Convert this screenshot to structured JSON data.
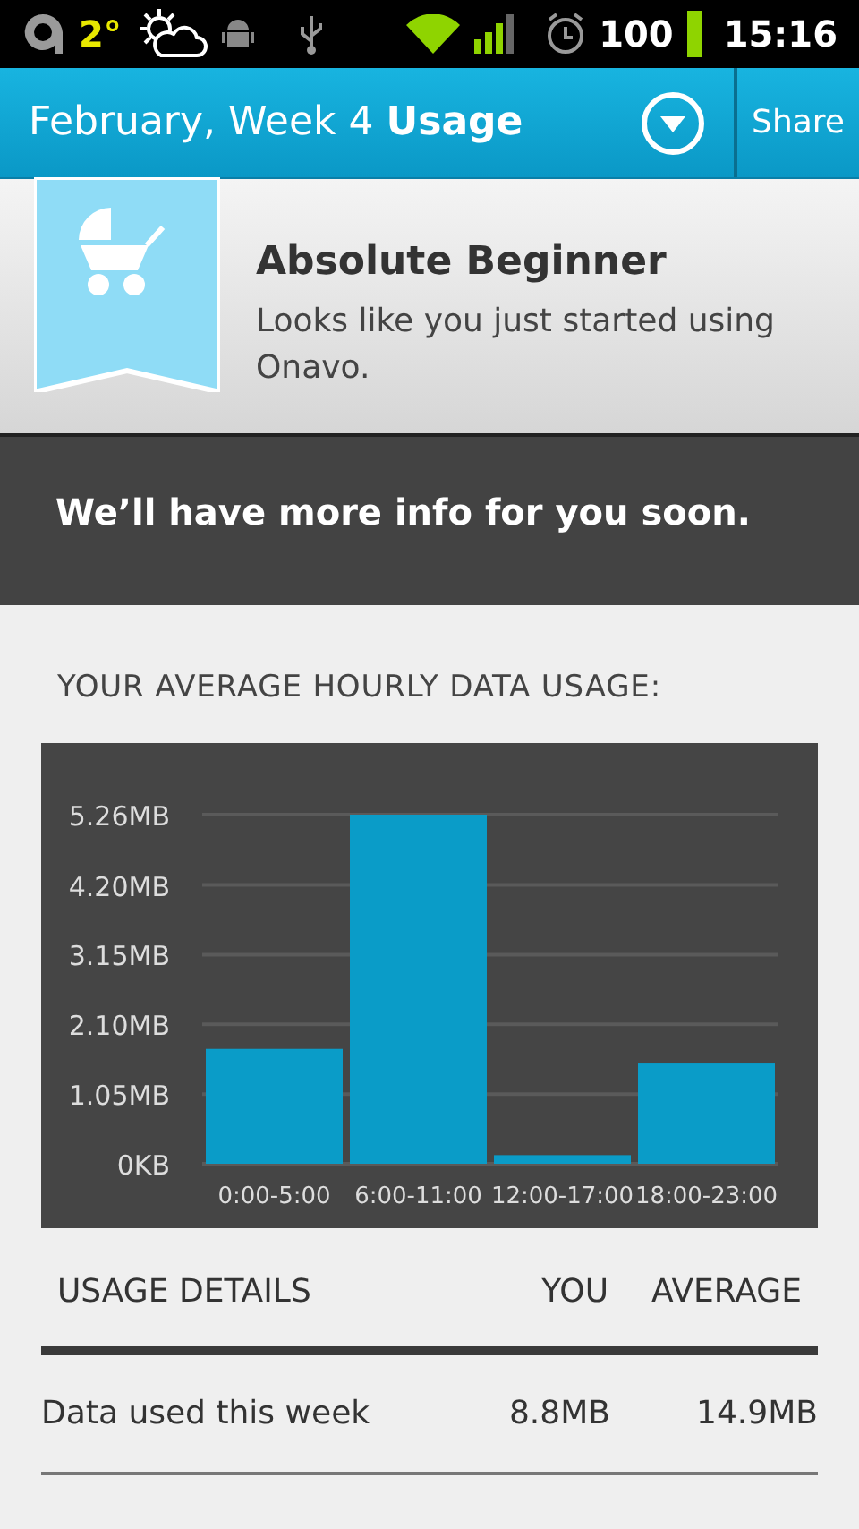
{
  "status_bar": {
    "temperature": "2°",
    "battery": "100",
    "time": "15:16"
  },
  "header": {
    "title": "February, Week 4",
    "title_bold": "Usage",
    "share": "Share"
  },
  "badge": {
    "title": "Absolute Beginner",
    "text": "Looks like you just started using Onavo."
  },
  "banner": "We’ll have more info for you soon.",
  "chart_section": {
    "title": "YOUR AVERAGE HOURLY DATA USAGE:",
    "chart_data": {
      "type": "bar",
      "categories": [
        "0:00-5:00",
        "6:00-11:00",
        "12:00-17:00",
        "18:00-23:00"
      ],
      "series": [
        {
          "color": "#0a9cc8",
          "values": [
            1.73,
            5.26,
            0.13,
            1.51
          ]
        }
      ],
      "ylim": [
        0,
        5.26
      ],
      "grid": true,
      "yticks": [
        {
          "value": 0,
          "label": "0KB"
        },
        {
          "value": 1.05,
          "label": "1.05MB"
        },
        {
          "value": 2.1,
          "label": "2.10MB"
        },
        {
          "value": 3.15,
          "label": "3.15MB"
        },
        {
          "value": 4.2,
          "label": "4.20MB"
        },
        {
          "value": 5.26,
          "label": "5.26MB"
        }
      ]
    }
  },
  "table": {
    "columns": [
      "USAGE DETAILS",
      "YOU",
      "AVERAGE"
    ],
    "rows": [
      {
        "label": "Data used this week",
        "you": "8.8MB",
        "average": "14.9MB"
      }
    ]
  }
}
